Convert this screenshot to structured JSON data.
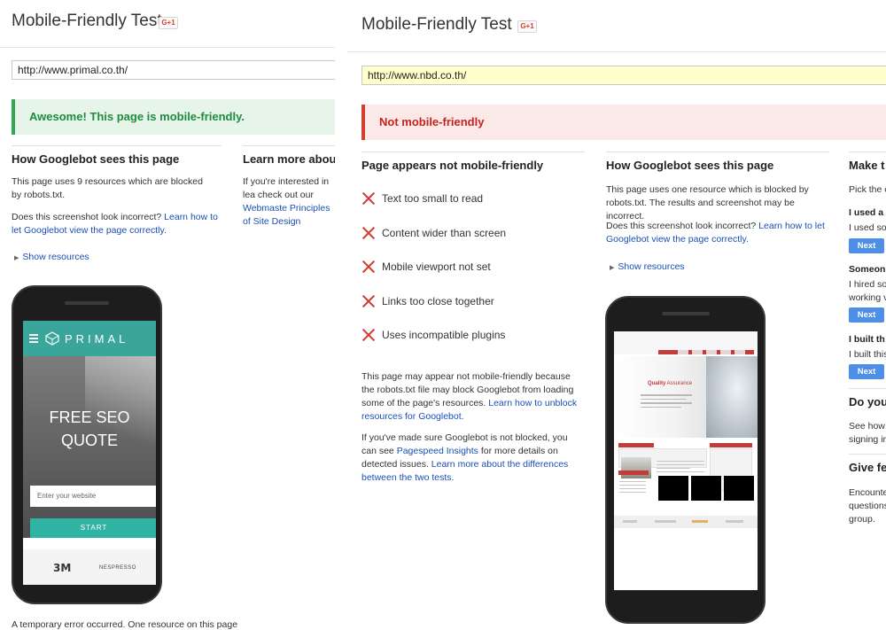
{
  "left": {
    "title": "Mobile-Friendly Test",
    "gplus": "G+1",
    "url": "http://www.primal.co.th/",
    "banner": "Awesome! This page is mobile-friendly.",
    "googlebot": {
      "heading": "How Googlebot sees this page",
      "blocked": "This page uses 9 resources which are blocked by robots.txt.",
      "incorrect_prefix": "Does this screenshot look incorrect? ",
      "incorrect_link": "Learn how to let Googlebot view the page correctly.",
      "show_resources": "Show resources",
      "error": "A temporary error occurred. One resource on this page"
    },
    "learn_more": {
      "heading": "Learn more about",
      "text_prefix": "If you're interested in lea check out our ",
      "link1": "Webmaste",
      "link2": "Principles of Site Design"
    },
    "phone": {
      "brand": "PRIMAL",
      "headline_1": "FREE SEO",
      "headline_2": "QUOTE",
      "input_placeholder": "Enter your website",
      "button": "START",
      "client_logo_1": "3M",
      "client_logo_2": "NESPRESSO"
    }
  },
  "right": {
    "title": "Mobile-Friendly Test",
    "gplus": "G+1",
    "url": "http://www.nbd.co.th/",
    "banner": "Not mobile-friendly",
    "issues": {
      "heading": "Page appears not mobile-friendly",
      "items": [
        "Text too small to read",
        "Content wider than screen",
        "Mobile viewport not set",
        "Links too close together",
        "Uses incompatible plugins"
      ],
      "note1_prefix": "This page may appear not mobile-friendly because the robots.txt file may block Googlebot from loading some of the page's resources. ",
      "note1_link": "Learn how to unblock resources for Googlebot.",
      "note2_prefix": "If you've made sure Googlebot is not blocked, you can see ",
      "note2_link1": "Pagespeed Insights",
      "note2_mid": " for more details on detected issues. ",
      "note2_link2": "Learn more about the differences between the two tests."
    },
    "googlebot": {
      "heading": "How Googlebot sees this page",
      "blocked": "This page uses one resource which is blocked by robots.txt. The results and screenshot may be incorrect.",
      "incorrect_prefix": "Does this screenshot look incorrect? ",
      "incorrect_link": "Learn how to let Googlebot view the page correctly.",
      "show_resources": "Show resources"
    },
    "phone": {
      "hero_title": "Quality",
      "hero_title_rest": " Assurance"
    },
    "side": {
      "heading": "Make t",
      "pick": "Pick the c",
      "q1_title": "I used a",
      "q1_text": "I used so",
      "q2_title": "Someon",
      "q2_text_1": "I hired so",
      "q2_text_2": "working v",
      "q3_title": "I built th",
      "q3_text": "I built this",
      "next": "Next",
      "do_you": "Do you",
      "see_how_1": "See how",
      "see_how_2": "signing in",
      "give_fe": "Give fe",
      "encounter_1": "Encounte",
      "encounter_2": "questions",
      "group_link": "group."
    }
  }
}
